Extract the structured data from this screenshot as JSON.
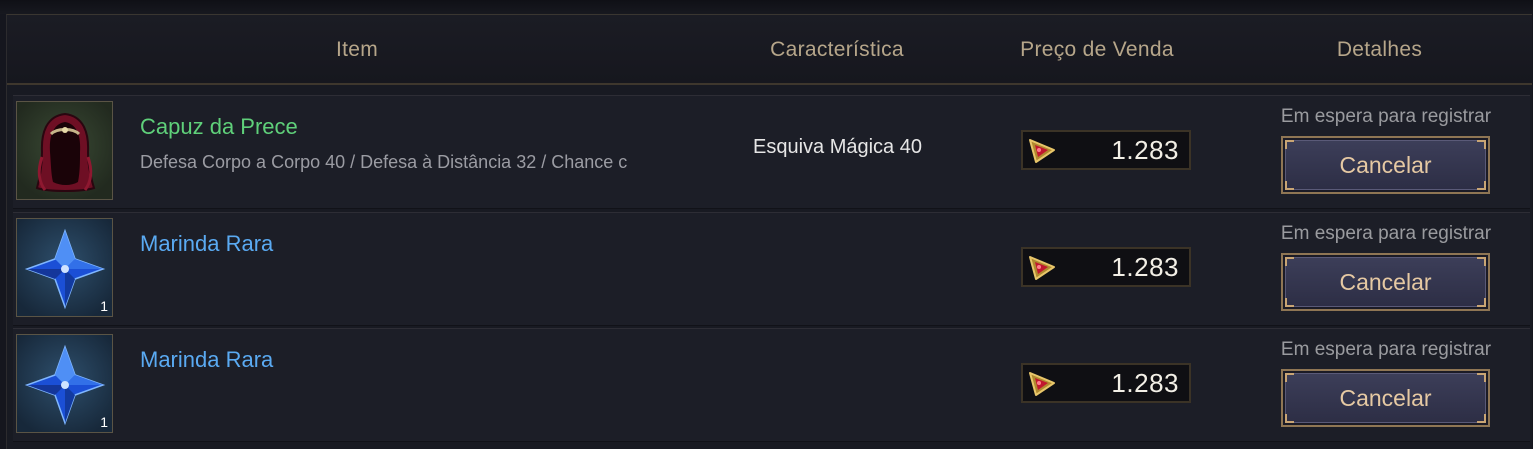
{
  "header": {
    "item": "Item",
    "feature": "Característica",
    "sale_price": "Preço de Venda",
    "details": "Detalhes"
  },
  "rows": [
    {
      "icon": "hood-icon",
      "name": "Capuz da Prece",
      "description": "Defesa Corpo a Corpo 40 / Defesa à Distância 32 / Chance c",
      "feature": "Esquiva Mágica 40",
      "price": "1.283",
      "status": "Em espera para registrar",
      "button": "Cancelar"
    },
    {
      "icon": "blue-crystal-icon",
      "name": "Marinda Rara",
      "quantity": "1",
      "price": "1.283",
      "status": "Em espera para registrar",
      "button": "Cancelar"
    },
    {
      "icon": "blue-crystal-icon",
      "name": "Marinda Rara",
      "quantity": "1",
      "price": "1.283",
      "status": "Em espera para registrar",
      "button": "Cancelar"
    }
  ],
  "colors": {
    "uncommon_name": "#5fd07a",
    "rare_name": "#5aaaf2",
    "header_text": "#b6a68a",
    "button_text": "#e6c9a3"
  }
}
